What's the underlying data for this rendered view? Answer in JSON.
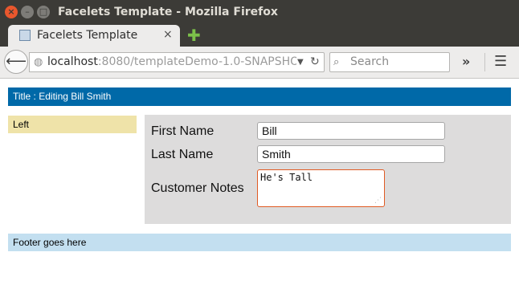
{
  "window": {
    "title": "Facelets Template - Mozilla Firefox",
    "close_glyph": "×",
    "minimize_glyph": "–",
    "maximize_glyph": "□"
  },
  "tab": {
    "label": "Facelets Template",
    "close_glyph": "×",
    "new_tab_glyph": "✚"
  },
  "navbar": {
    "back_glyph": "⟵",
    "url_host": "localhost",
    "url_rest": ":8080/templateDemo-1.0-SNAPSHOT",
    "dropdown_glyph": "▼",
    "reload_glyph": "↻",
    "search_placeholder": "Search",
    "search_glyph": "⌕",
    "overflow_glyph": "»",
    "menu_glyph": "☰",
    "icons": {
      "back": "back-arrow-icon",
      "site": "globe-icon",
      "reload": "reload-icon",
      "search": "search-icon",
      "overflow": "chevron-double-right-icon",
      "menu": "hamburger-menu-icon"
    }
  },
  "page": {
    "header": "Title : Editing Bill Smith",
    "left": "Left",
    "footer": "Footer goes here",
    "form": {
      "first_name_label": "First Name",
      "first_name_value": "Bill",
      "last_name_label": "Last Name",
      "last_name_value": "Smith",
      "notes_label": "Customer Notes",
      "notes_value": "He's Tall"
    }
  },
  "colors": {
    "header_bg": "#0069a8",
    "left_bg": "#efe3a9",
    "content_bg": "#dddcdc",
    "footer_bg": "#c3dff0",
    "focus_border": "#e05b24"
  }
}
